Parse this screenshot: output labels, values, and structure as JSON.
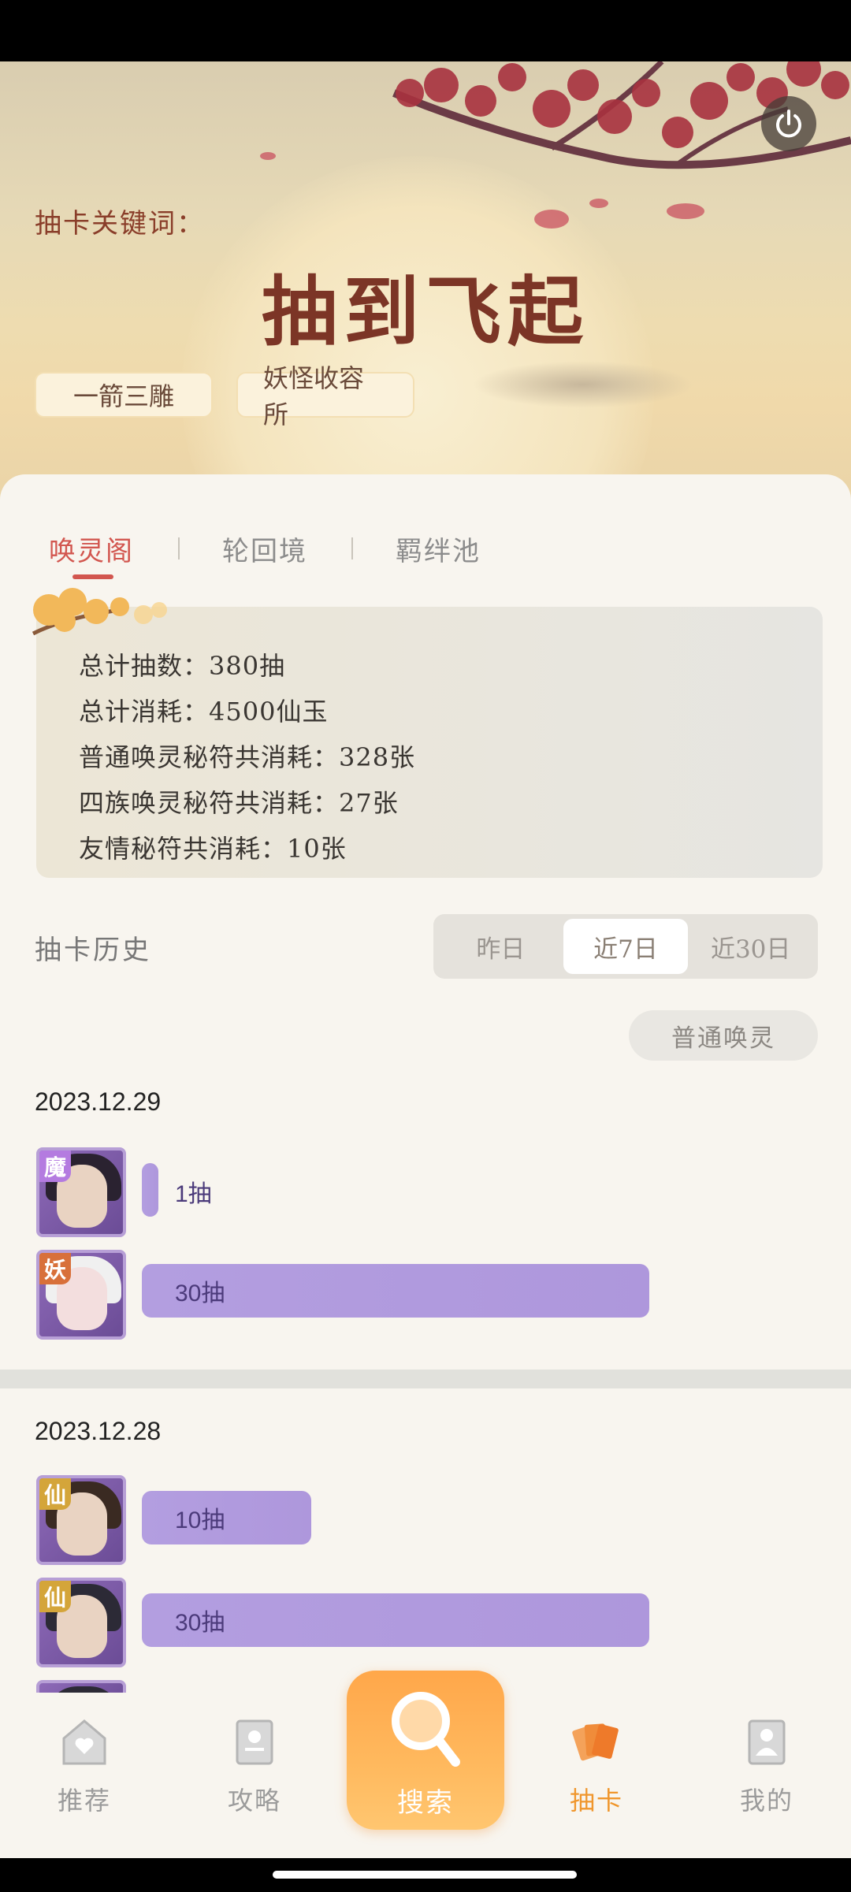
{
  "hero": {
    "keyword_label": "抽卡关键词：",
    "keyword_title": "抽到飞起",
    "tags": [
      "一箭三雕",
      "妖怪收容所"
    ]
  },
  "tabs": [
    "唤灵阁",
    "轮回境",
    "羁绊池"
  ],
  "active_tab": "唤灵阁",
  "stats": {
    "lines": [
      "总计抽数：380抽",
      "总计消耗：4500仙玉",
      "普通唤灵秘符共消耗：328张",
      "四族唤灵秘符共消耗：27张",
      "友情秘符共消耗：10张"
    ]
  },
  "history": {
    "title": "抽卡历史",
    "periods": [
      "昨日",
      "近7日",
      "近30日"
    ],
    "active_period": "近7日",
    "filter": "普通唤灵",
    "groups": [
      {
        "date": "2023.12.29",
        "entries": [
          {
            "badge": "魔",
            "count": "1抽",
            "value": 1
          },
          {
            "badge": "妖",
            "count": "30抽",
            "value": 30
          }
        ]
      },
      {
        "date": "2023.12.28",
        "entries": [
          {
            "badge": "仙",
            "count": "10抽",
            "value": 10
          },
          {
            "badge": "仙",
            "count": "30抽",
            "value": 30
          }
        ]
      }
    ]
  },
  "nav": {
    "items": [
      "推荐",
      "攻略",
      "搜索",
      "抽卡",
      "我的"
    ],
    "active": "抽卡"
  },
  "colors": {
    "accent_red": "#d2564f",
    "bar_purple": "#b39ee0",
    "nav_active": "#f0962c",
    "search_orange": "#ffa74a"
  }
}
